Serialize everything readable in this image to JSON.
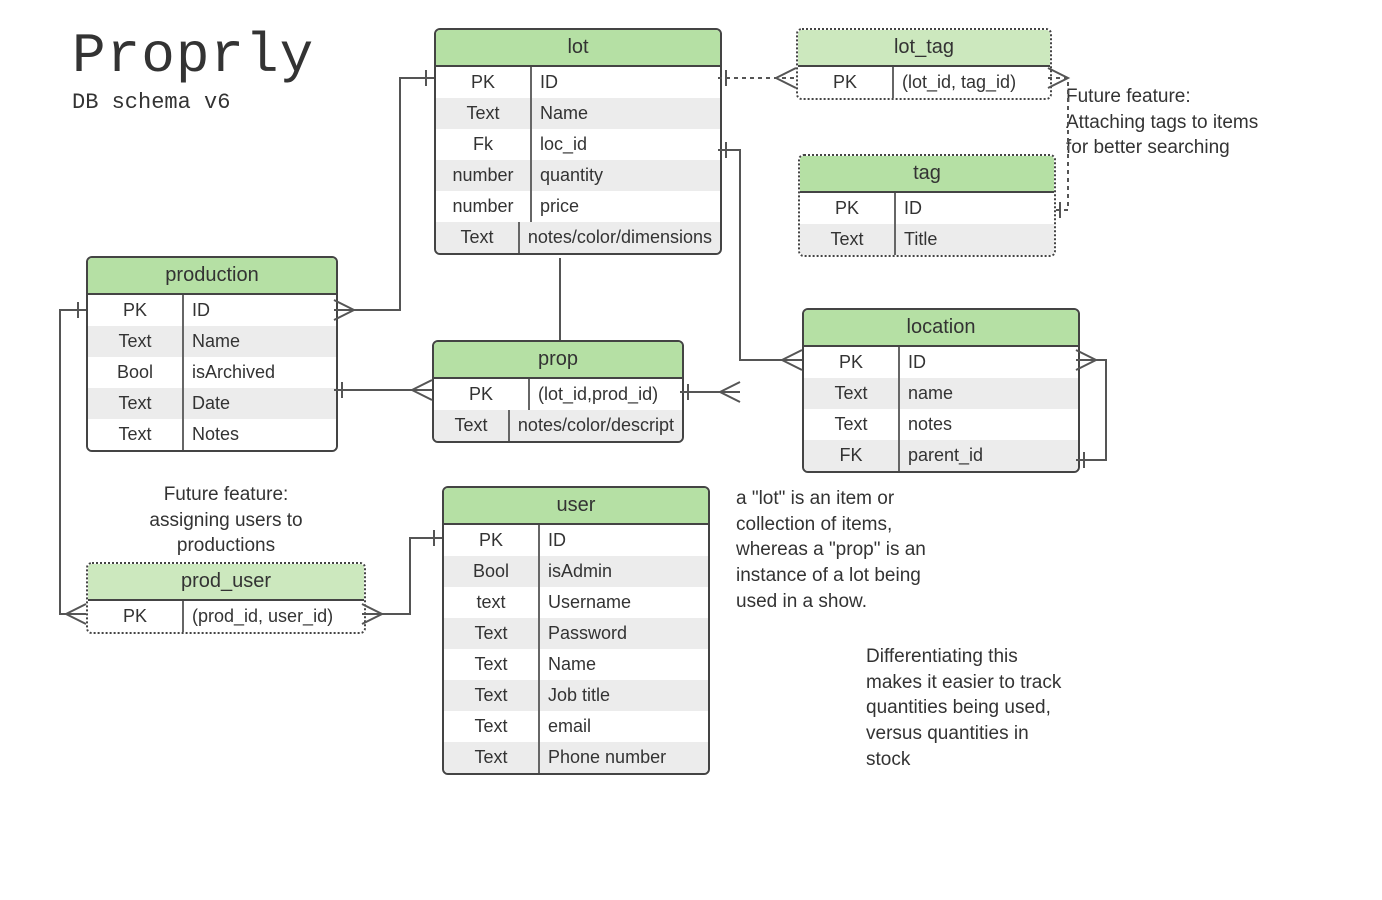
{
  "header": {
    "title": "Proprly",
    "subtitle": "DB schema v6"
  },
  "entities": {
    "lot": {
      "title": "lot",
      "rows": [
        {
          "c1": "PK",
          "c2": "ID"
        },
        {
          "c1": "Text",
          "c2": "Name"
        },
        {
          "c1": "Fk",
          "c2": "loc_id"
        },
        {
          "c1": "number",
          "c2": "quantity"
        },
        {
          "c1": "number",
          "c2": "price"
        },
        {
          "c1": "Text",
          "c2": "notes/color/dimensions"
        }
      ]
    },
    "lot_tag": {
      "title": "lot_tag",
      "rows": [
        {
          "c1": "PK",
          "c2": "(lot_id, tag_id)"
        }
      ]
    },
    "tag": {
      "title": "tag",
      "rows": [
        {
          "c1": "PK",
          "c2": "ID"
        },
        {
          "c1": "Text",
          "c2": "Title"
        }
      ]
    },
    "production": {
      "title": "production",
      "rows": [
        {
          "c1": "PK",
          "c2": "ID"
        },
        {
          "c1": "Text",
          "c2": "Name"
        },
        {
          "c1": "Bool",
          "c2": "isArchived"
        },
        {
          "c1": "Text",
          "c2": "Date"
        },
        {
          "c1": "Text",
          "c2": "Notes"
        }
      ]
    },
    "prop": {
      "title": "prop",
      "rows": [
        {
          "c1": "PK",
          "c2": "(lot_id,prod_id)"
        },
        {
          "c1": "Text",
          "c2": "notes/color/descript"
        }
      ]
    },
    "location": {
      "title": "location",
      "rows": [
        {
          "c1": "PK",
          "c2": "ID"
        },
        {
          "c1": "Text",
          "c2": "name"
        },
        {
          "c1": "Text",
          "c2": "notes"
        },
        {
          "c1": "FK",
          "c2": "parent_id"
        }
      ]
    },
    "user": {
      "title": "user",
      "rows": [
        {
          "c1": "PK",
          "c2": "ID"
        },
        {
          "c1": "Bool",
          "c2": "isAdmin"
        },
        {
          "c1": "text",
          "c2": "Username"
        },
        {
          "c1": "Text",
          "c2": "Password"
        },
        {
          "c1": "Text",
          "c2": "Name"
        },
        {
          "c1": "Text",
          "c2": "Job title"
        },
        {
          "c1": "Text",
          "c2": "email"
        },
        {
          "c1": "Text",
          "c2": "Phone number"
        }
      ]
    },
    "prod_user": {
      "title": "prod_user",
      "rows": [
        {
          "c1": "PK",
          "c2": "(prod_id, user_id)"
        }
      ]
    }
  },
  "notes": {
    "tags_future": "Future feature:\nAttaching tags to items\nfor better searching",
    "users_future": "Future feature:\nassigning users to\nproductions",
    "lot_desc": "a \"lot\" is an item or\ncollection of items,\nwhereas a \"prop\" is an\ninstance of a lot being\nused in a show.",
    "diff_desc": "Differentiating this\nmakes it easier to track\nquantities being used,\nversus quantities in\nstock"
  }
}
